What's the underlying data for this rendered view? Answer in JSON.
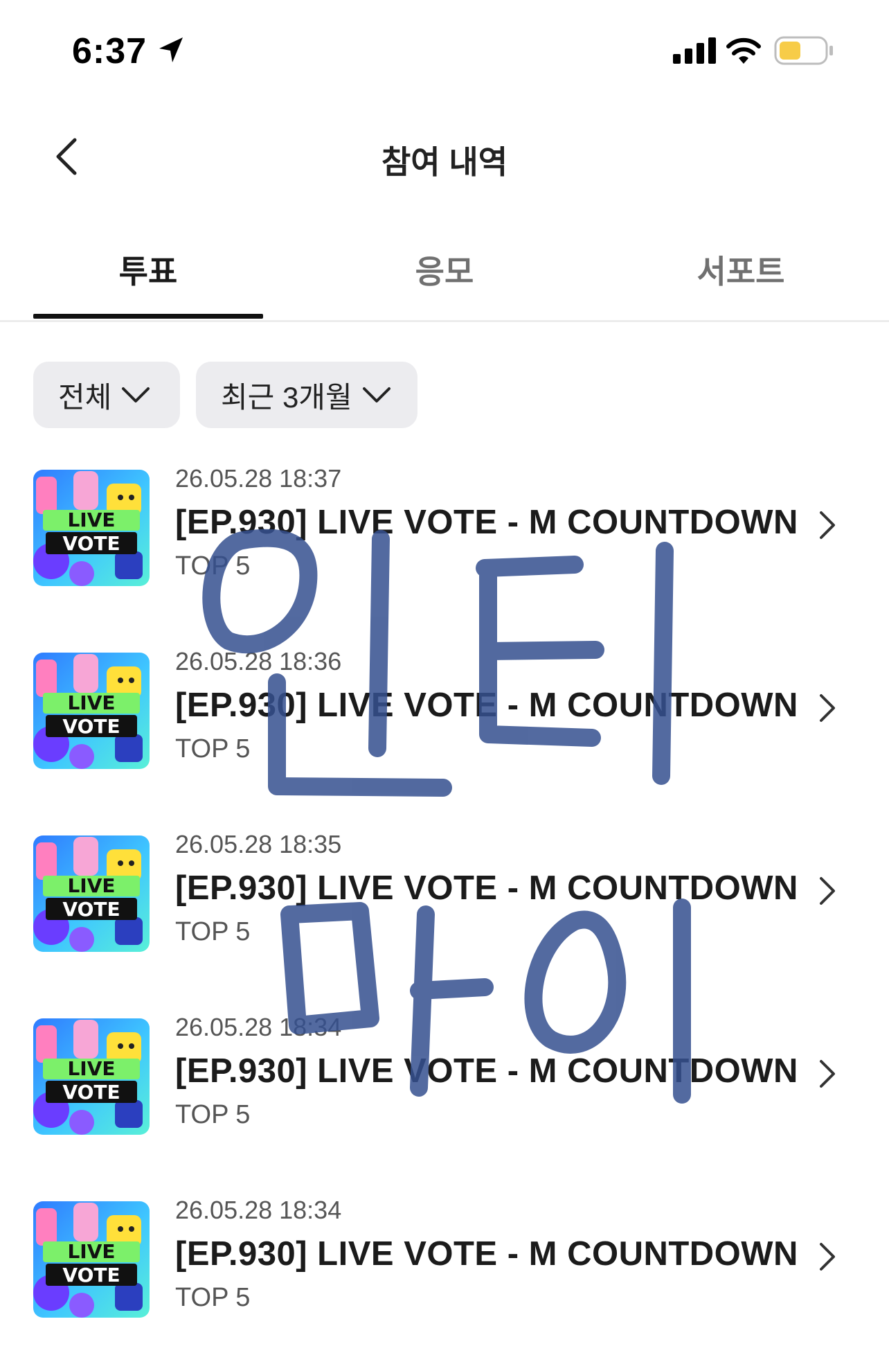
{
  "status_bar": {
    "time": "6:37",
    "battery_color": "#f7cc48"
  },
  "header": {
    "title": "참여 내역"
  },
  "tabs": [
    {
      "label": "투표",
      "active": true
    },
    {
      "label": "응모",
      "active": false
    },
    {
      "label": "서포트",
      "active": false
    }
  ],
  "filters": {
    "category": "전체",
    "period": "최근 3개월"
  },
  "items": [
    {
      "date": "26.05.28 18:37",
      "title": "[EP.930] LIVE VOTE - M COUNTDOWN",
      "subtitle": "TOP 5",
      "thumb_line1": "LIVE",
      "thumb_line2": "VOTE"
    },
    {
      "date": "26.05.28 18:36",
      "title": "[EP.930] LIVE VOTE - M COUNTDOWN",
      "subtitle": "TOP 5",
      "thumb_line1": "LIVE",
      "thumb_line2": "VOTE"
    },
    {
      "date": "26.05.28 18:35",
      "title": "[EP.930] LIVE VOTE - M COUNTDOWN",
      "subtitle": "TOP 5",
      "thumb_line1": "LIVE",
      "thumb_line2": "VOTE"
    },
    {
      "date": "26.05.28 18:34",
      "title": "[EP.930] LIVE VOTE - M COUNTDOWN",
      "subtitle": "TOP 5",
      "thumb_line1": "LIVE",
      "thumb_line2": "VOTE"
    },
    {
      "date": "26.05.28 18:34",
      "title": "[EP.930] LIVE VOTE - M COUNTDOWN",
      "subtitle": "TOP 5",
      "thumb_line1": "LIVE",
      "thumb_line2": "VOTE"
    }
  ],
  "overlay": {
    "handwritten_text": [
      "인티",
      "마이"
    ],
    "ink_color": "#35508f"
  }
}
